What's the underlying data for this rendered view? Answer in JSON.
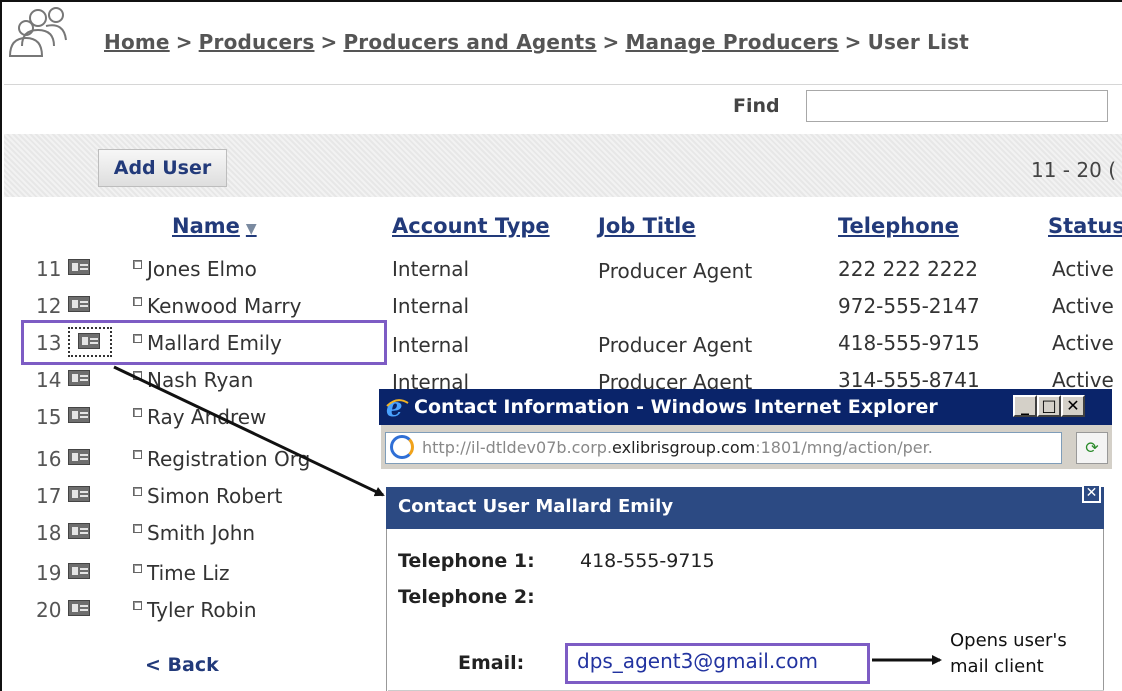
{
  "breadcrumb": {
    "items": [
      "Home",
      "Producers",
      "Producers and Agents",
      "Manage Producers"
    ],
    "separator": ">",
    "current": "User List"
  },
  "find": {
    "label": "Find",
    "value": ""
  },
  "toolbar": {
    "add_user_label": "Add User",
    "range_text": "11 - 20 ("
  },
  "table": {
    "columns": {
      "name": "Name",
      "account_type": "Account Type",
      "job_title": "Job Title",
      "telephone": "Telephone",
      "status": "Status"
    },
    "rows": [
      {
        "num": "11",
        "name": "Jones Elmo",
        "account_type": "Internal",
        "job_title": "Producer Agent",
        "telephone": "222 222 2222",
        "status": "Active"
      },
      {
        "num": "12",
        "name": "Kenwood Marry",
        "account_type": "Internal",
        "job_title": "",
        "telephone": "972-555-2147",
        "status": "Active"
      },
      {
        "num": "13",
        "name": "Mallard Emily",
        "account_type": "Internal",
        "job_title": "Producer Agent",
        "telephone": "418-555-9715",
        "status": "Active"
      },
      {
        "num": "14",
        "name": "Nash Ryan",
        "account_type": "Internal",
        "job_title": "Producer Agent",
        "telephone": "314-555-8741",
        "status": "Active"
      },
      {
        "num": "15",
        "name": "Ray Andrew"
      },
      {
        "num": "16",
        "name": "Registration Org"
      },
      {
        "num": "17",
        "name": "Simon Robert"
      },
      {
        "num": "18",
        "name": "Smith John"
      },
      {
        "num": "19",
        "name": "Time Liz"
      },
      {
        "num": "20",
        "name": "Tyler Robin"
      }
    ]
  },
  "back_label": "< Back",
  "popup": {
    "window_title": "Contact Information - Windows Internet Explorer",
    "address_pre": "http://il-dtldev07b.corp.",
    "address_domain": "exlibrisgroup.com",
    "address_post": ":1801/mng/action/per.",
    "contact_title": "Contact User  Mallard Emily",
    "telephone1_label": "Telephone 1:",
    "telephone1_value": "418-555-9715",
    "telephone2_label": "Telephone 2:",
    "email_label": "Email:",
    "email_value": "dps_agent3@gmail.com"
  },
  "annotation": {
    "line1": "Opens user's",
    "line2": "mail client"
  },
  "colors": {
    "highlight": "#7d5cc4",
    "link": "#223a7a",
    "titlebar": "#0a246a",
    "dialog_header": "#2c4a83"
  }
}
